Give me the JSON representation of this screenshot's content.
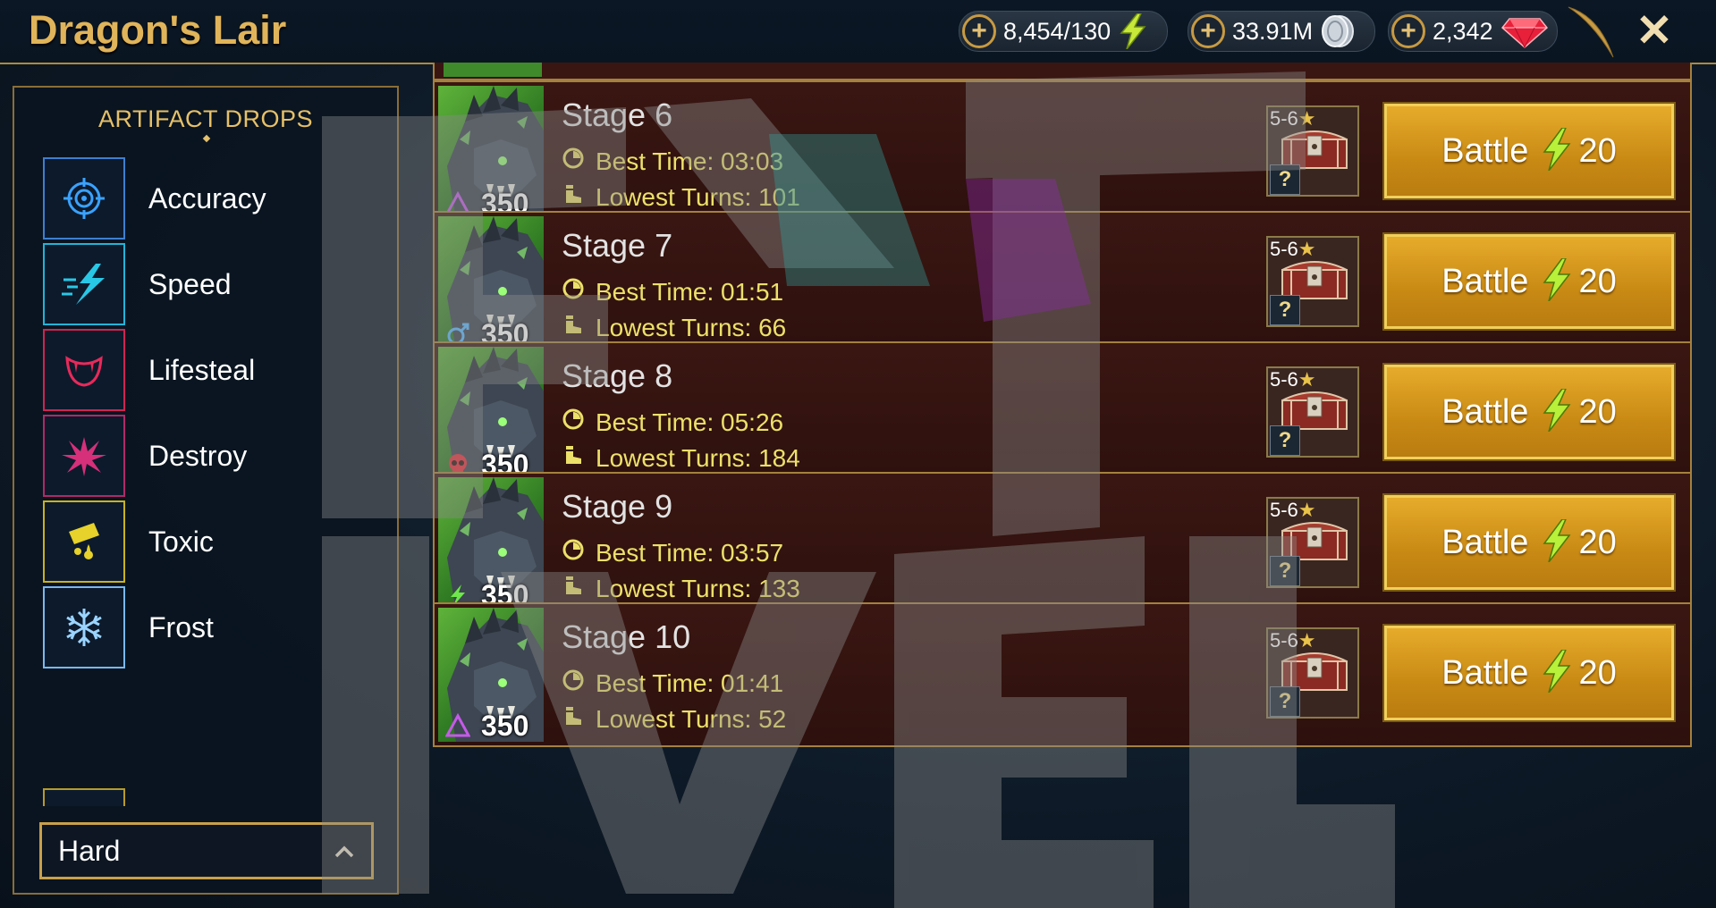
{
  "header": {
    "title": "Dragon's Lair",
    "energy": "8,454/130",
    "silver": "33.91M",
    "gems": "2,342",
    "close_label": "✕"
  },
  "sidebar": {
    "title": "ARTIFACT DROPS",
    "items": [
      {
        "label": "Accuracy",
        "icon": "accuracy-icon",
        "color": "#4aa8ff"
      },
      {
        "label": "Speed",
        "icon": "speed-icon",
        "color": "#29c7e6"
      },
      {
        "label": "Lifesteal",
        "icon": "lifesteal-icon",
        "color": "#e82a5a"
      },
      {
        "label": "Destroy",
        "icon": "destroy-icon",
        "color": "#d6307a"
      },
      {
        "label": "Toxic",
        "icon": "toxic-icon",
        "color": "#e6d22a"
      },
      {
        "label": "Frost",
        "icon": "frost-icon",
        "color": "#8fd0ff"
      }
    ],
    "difficulty": "Hard"
  },
  "stages": [
    {
      "name": "Stage 6",
      "level": "350",
      "best_time": "Best Time: 03:03",
      "lowest_turns": "Lowest Turns: 101",
      "rank": "5-6",
      "battle_label": "Battle",
      "cost": "20",
      "affinity": "magic"
    },
    {
      "name": "Stage 7",
      "level": "350",
      "best_time": "Best Time: 01:51",
      "lowest_turns": "Lowest Turns: 66",
      "rank": "5-6",
      "battle_label": "Battle",
      "cost": "20",
      "affinity": "void"
    },
    {
      "name": "Stage 8",
      "level": "350",
      "best_time": "Best Time: 05:26",
      "lowest_turns": "Lowest Turns: 184",
      "rank": "5-6",
      "battle_label": "Battle",
      "cost": "20",
      "affinity": "force"
    },
    {
      "name": "Stage 9",
      "level": "350",
      "best_time": "Best Time: 03:57",
      "lowest_turns": "Lowest Turns: 133",
      "rank": "5-6",
      "battle_label": "Battle",
      "cost": "20",
      "affinity": "spirit"
    },
    {
      "name": "Stage 10",
      "level": "350",
      "best_time": "Best Time: 01:41",
      "lowest_turns": "Lowest Turns: 52",
      "rank": "5-6",
      "battle_label": "Battle",
      "cost": "20",
      "affinity": "magic"
    }
  ],
  "colors": {
    "accent_gold": "#e0b45a",
    "stat_yellow": "#ede06a",
    "battle_orange": "#d9981c",
    "row_bg": "#3a1612"
  }
}
